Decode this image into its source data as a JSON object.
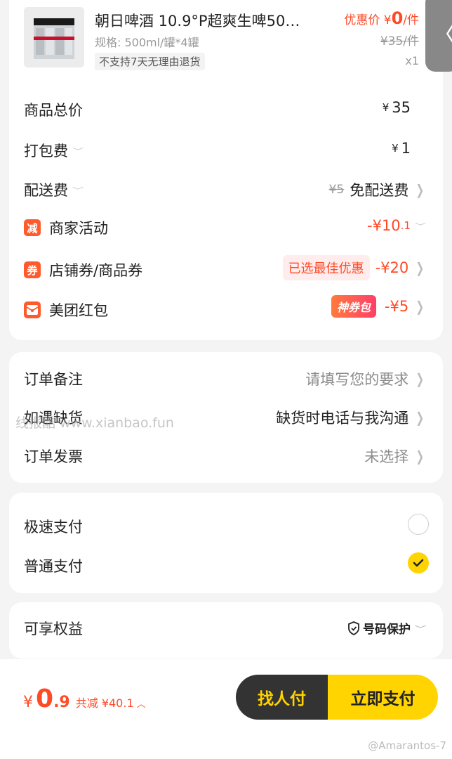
{
  "product": {
    "name": "朝日啤酒 10.9°P超爽生啤50…",
    "spec": "规格: 500ml/罐*4罐",
    "badge": "不支持7天无理由退货",
    "deal_label": "优惠价 ¥",
    "deal_price": "0",
    "deal_unit": "/件",
    "original_price": "¥35/件",
    "qty": "x1"
  },
  "fees": {
    "total": {
      "label": "商品总价",
      "currency": "¥",
      "value": "35"
    },
    "packing": {
      "label": "打包费",
      "currency": "¥",
      "value": "1"
    },
    "delivery": {
      "label": "配送费",
      "original": "¥5",
      "value": "免配送费"
    },
    "merchant": {
      "icon_text": "减",
      "label": "商家活动",
      "value": "-¥10",
      "value_small": ".1"
    },
    "coupon": {
      "icon_text": "券",
      "label": "店铺券/商品券",
      "tag": "已选最佳优惠",
      "value": "-¥20"
    },
    "redpack": {
      "label": "美团红包",
      "tag": "神券包",
      "value": "-¥5"
    }
  },
  "notes": {
    "remark": {
      "label": "订单备注",
      "value": "请填写您的要求"
    },
    "stockout": {
      "label": "如遇缺货",
      "value": "缺货时电话与我沟通"
    },
    "invoice": {
      "label": "订单发票",
      "value": "未选择"
    }
  },
  "payment": {
    "fast": {
      "label": "极速支付",
      "selected": false
    },
    "normal": {
      "label": "普通支付",
      "selected": true
    }
  },
  "rights": {
    "label": "可享权益",
    "value": "号码保护"
  },
  "bottom": {
    "currency": "¥",
    "amount": "0",
    "amount_small": ".9",
    "saved": "共减 ¥40.1",
    "btn_friend": "找人付",
    "btn_pay": "立即支付"
  },
  "overlay": {
    "watermark": "线报酷 www.xianbao.fun",
    "credit": "@Amarantos-7",
    "back_glyph": "〈"
  },
  "colors": {
    "accent_red": "#ff4a26",
    "brand_yellow": "#ffd400",
    "dark_button": "#333333"
  }
}
